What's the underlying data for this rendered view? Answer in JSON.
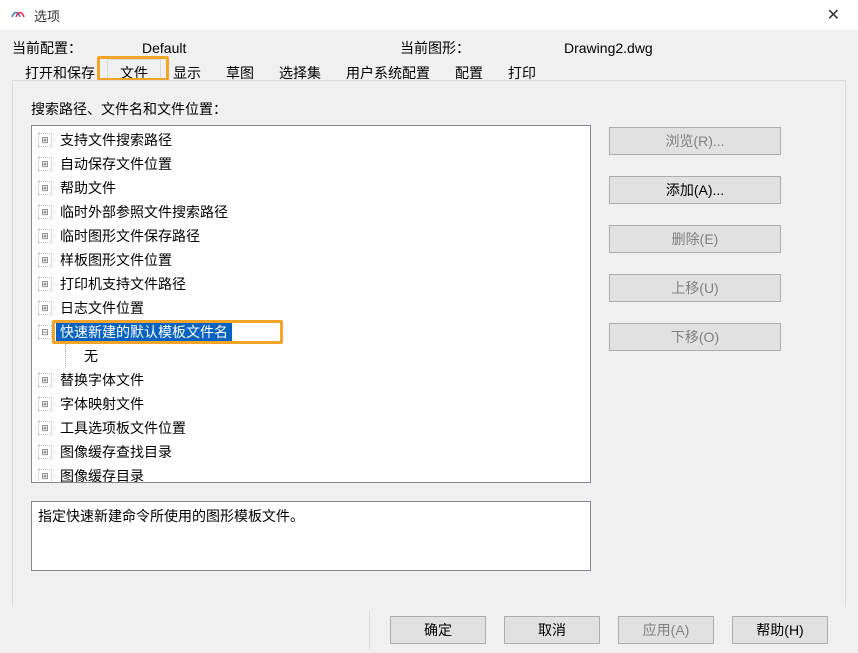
{
  "window": {
    "title": "选项",
    "close": "✕"
  },
  "info": {
    "config_label": "当前配置：",
    "config_value": "Default",
    "drawing_label": "当前图形：",
    "drawing_value": "Drawing2.dwg"
  },
  "tabs": {
    "items": [
      {
        "label": "打开和保存"
      },
      {
        "label": "文件"
      },
      {
        "label": "显示"
      },
      {
        "label": "草图"
      },
      {
        "label": "选择集"
      },
      {
        "label": "用户系统配置"
      },
      {
        "label": "配置"
      },
      {
        "label": "打印"
      }
    ],
    "active_index": 1
  },
  "section_label": "搜索路径、文件名和文件位置：",
  "tree": {
    "items": [
      {
        "label": "支持文件搜索路径",
        "expanded": false
      },
      {
        "label": "自动保存文件位置",
        "expanded": false
      },
      {
        "label": "帮助文件",
        "expanded": false
      },
      {
        "label": "临时外部参照文件搜索路径",
        "expanded": false
      },
      {
        "label": "临时图形文件保存路径",
        "expanded": false
      },
      {
        "label": "样板图形文件位置",
        "expanded": false
      },
      {
        "label": "打印机支持文件路径",
        "expanded": false
      },
      {
        "label": "日志文件位置",
        "expanded": false
      },
      {
        "label": "快速新建的默认模板文件名",
        "expanded": true,
        "selected": true,
        "child": "无"
      },
      {
        "label": "替换字体文件",
        "expanded": false
      },
      {
        "label": "字体映射文件",
        "expanded": false
      },
      {
        "label": "工具选项板文件位置",
        "expanded": false
      },
      {
        "label": "图像缓存查找目录",
        "expanded": false
      },
      {
        "label": "图像缓存目录",
        "expanded": false
      }
    ]
  },
  "sidebuttons": {
    "browse": "浏览(R)...",
    "add": "添加(A)...",
    "delete": "删除(E)",
    "moveup": "上移(U)",
    "movedown": "下移(O)"
  },
  "description": "指定快速新建命令所使用的图形模板文件。",
  "bottom": {
    "ok": "确定",
    "cancel": "取消",
    "apply": "应用(A)",
    "help": "帮助(H)"
  }
}
